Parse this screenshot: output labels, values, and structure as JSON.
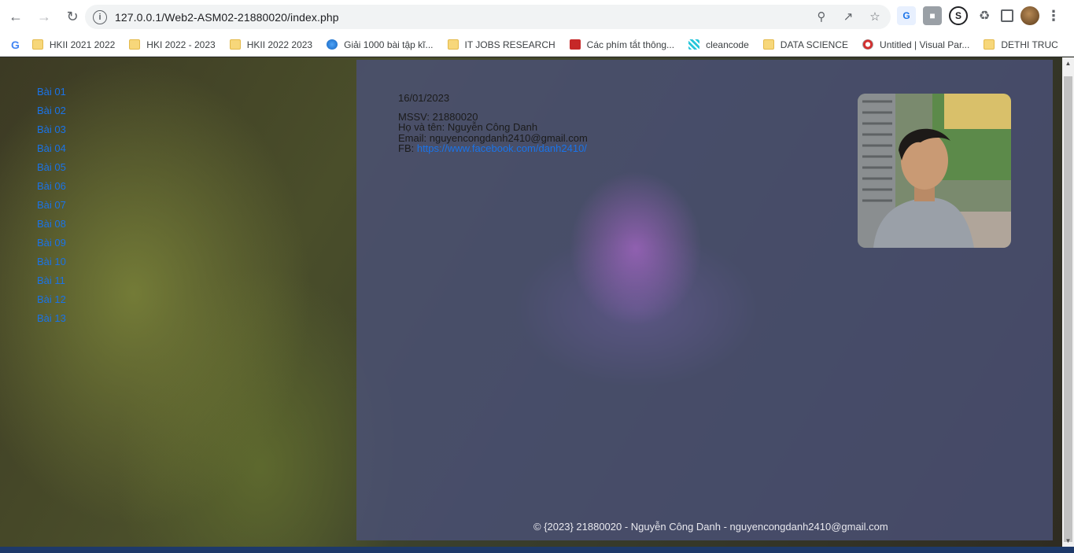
{
  "browser": {
    "url": "127.0.0.1/Web2-ASM02-21880020/index.php",
    "bookmarks": [
      {
        "label": "HKII 2021 2022",
        "icon": "folder-icon"
      },
      {
        "label": "HKI 2022 - 2023",
        "icon": "folder-icon"
      },
      {
        "label": "HKII 2022 2023",
        "icon": "folder-icon"
      },
      {
        "label": "Giải 1000 bài tập kĩ...",
        "icon": "globe-icon"
      },
      {
        "label": "IT JOBS RESEARCH",
        "icon": "folder-icon"
      },
      {
        "label": "Các phím tắt thông...",
        "icon": "red-app-icon"
      },
      {
        "label": "cleancode",
        "icon": "teal-grid-icon"
      },
      {
        "label": "DATA SCIENCE",
        "icon": "folder-icon"
      },
      {
        "label": "Untitled | Visual Par...",
        "icon": "visual-paradigm-icon"
      },
      {
        "label": "DETHI TRUC",
        "icon": "folder-icon"
      }
    ]
  },
  "sidebar": {
    "links": [
      "Bài 01",
      "Bài 02",
      "Bài 03",
      "Bài 04",
      "Bài 05",
      "Bài 06",
      "Bài 07",
      "Bài 08",
      "Bài 09",
      "Bài 10",
      "Bài 11",
      "Bài 12",
      "Bài 13"
    ]
  },
  "main": {
    "date": "16/01/2023",
    "mssv": "MSSV: 21880020",
    "name": "Họ và tên: Nguyễn Công Danh",
    "email": "Email: nguyencongdanh2410@gmail.com",
    "fb_label": "FB: ",
    "fb_url": "https://www.facebook.com/danh2410/"
  },
  "footer": {
    "text": "© {2023} 21880020 - Nguyễn Công Danh - nguyencongdanh2410@gmail.com"
  }
}
